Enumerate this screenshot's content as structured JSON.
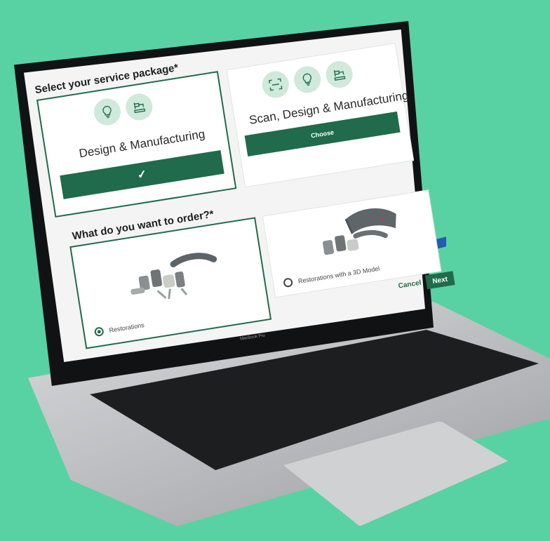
{
  "colors": {
    "background": "#58d2a3",
    "brand_green": "#206b4b",
    "icon_circle": "#cfe9da"
  },
  "device_label": "MacBook Pro",
  "service_package": {
    "heading": "Select your service package*",
    "options": [
      {
        "title": "Design & Manufacturing",
        "icons": [
          "lightbulb-icon",
          "milling-machine-icon"
        ],
        "button_label": "✓",
        "selected": true
      },
      {
        "title": "Scan, Design & Manufacturing",
        "icons": [
          "scan-icon",
          "lightbulb-icon",
          "milling-machine-icon"
        ],
        "button_label": "Choose",
        "selected": false
      }
    ]
  },
  "order": {
    "heading": "What do you want to order?*",
    "options": [
      {
        "label": "Restorations",
        "selected": true
      },
      {
        "label": "Restorations with a 3D Model",
        "selected": false
      }
    ]
  },
  "actions": {
    "cancel_label": "Cancel",
    "next_label": "Next"
  }
}
